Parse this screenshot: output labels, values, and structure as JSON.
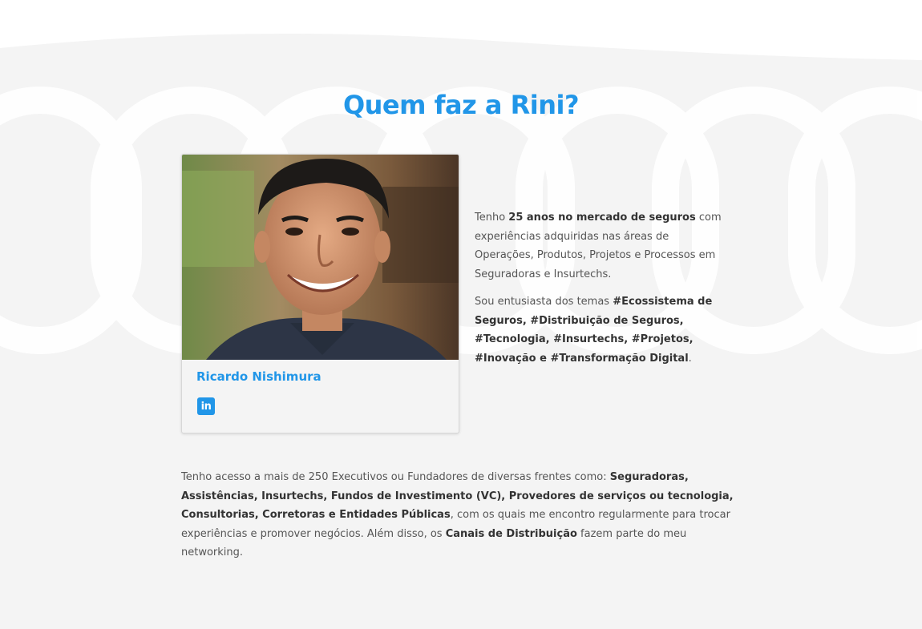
{
  "section": {
    "title": "Quem faz a Rini?"
  },
  "profile": {
    "name": "Ricardo Nishimura",
    "photo_icon": "person-photo",
    "social_icon": "linkedin-icon",
    "social_glyph": "in"
  },
  "bio": {
    "p1": {
      "t1": "Tenho ",
      "b1": "25 anos no mercado de seguros",
      "t2": " com experiências adquiridas nas áreas de Operações, Produtos, Projetos e Processos em Seguradoras e Insurtechs."
    },
    "p2": {
      "t1": "Sou entusiasta dos temas ",
      "b1": "#Ecossistema de Seguros, #Distribuição de Seguros, #Tecnologia, #Insurtechs, #Projetos, #Inovação e #Transformação Digital",
      "t2": "."
    }
  },
  "network": {
    "t1": "Tenho acesso a mais de 250 Executivos ou Fundadores de diversas frentes como: ",
    "b1": "Seguradoras, Assistências, Insurtechs, Fundos de Investimento (VC), Provedores de serviços ou tecnologia, Consultorias, Corretoras e Entidades Públicas",
    "t2": ", com os quais me encontro regularmente para trocar experiências e promover negócios. Além disso, os ",
    "b2": "Canais de Distribuição",
    "t3": " fazem parte do meu networking."
  },
  "colors": {
    "accent": "#2196e8",
    "section_bg": "#f4f4f4",
    "text": "#555555"
  }
}
